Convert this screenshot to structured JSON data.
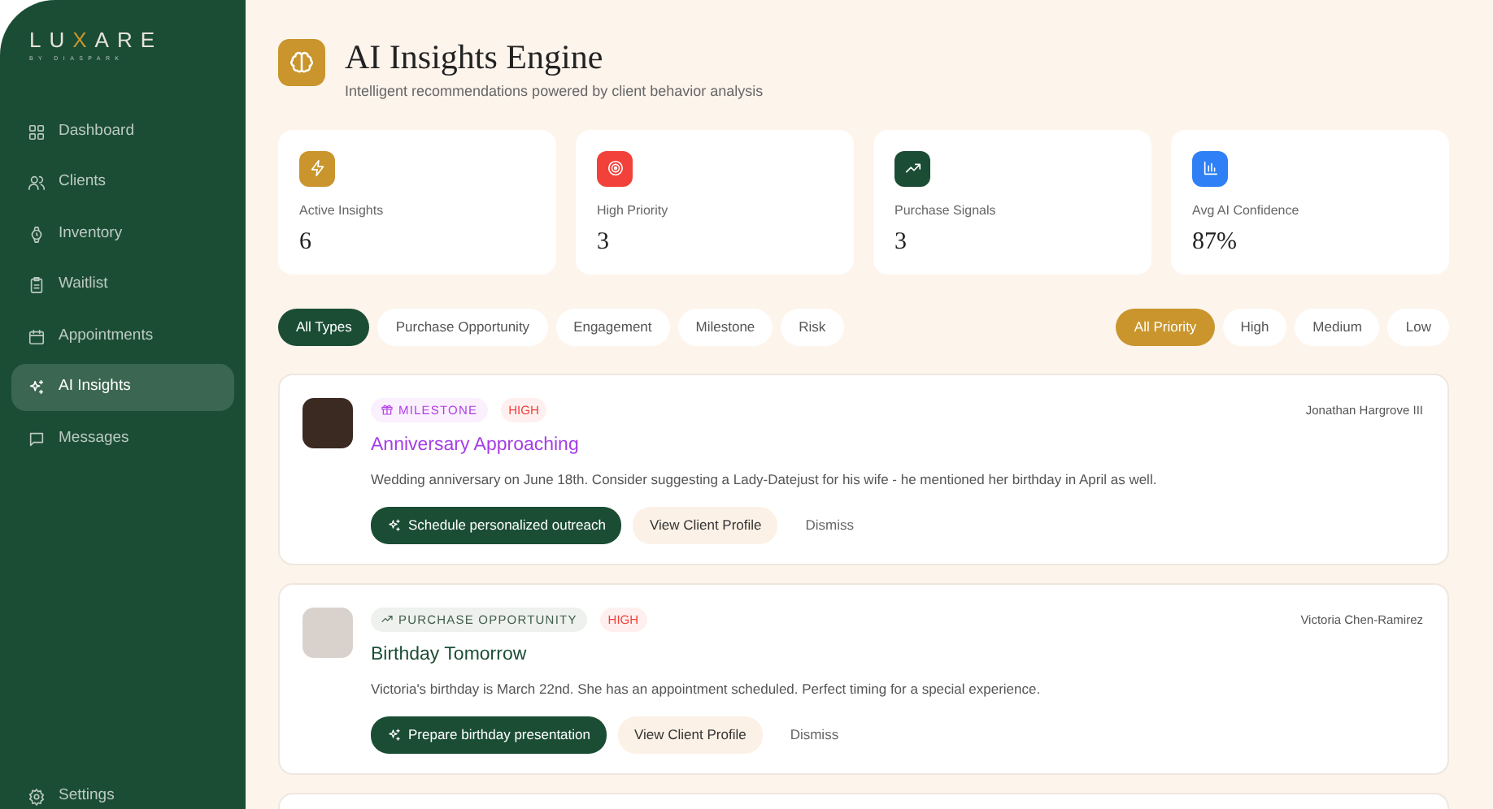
{
  "sidebar": {
    "logo": "LUXARE",
    "logo_subtitle": "BY DIASPARK",
    "items": [
      {
        "label": "Dashboard",
        "selected": false
      },
      {
        "label": "Clients",
        "selected": false
      },
      {
        "label": "Inventory",
        "selected": false
      },
      {
        "label": "Waitlist",
        "selected": false
      },
      {
        "label": "Appointments",
        "selected": false
      },
      {
        "label": "AI Insights",
        "selected": true
      },
      {
        "label": "Messages",
        "selected": false
      }
    ],
    "footer_item": "Settings"
  },
  "header": {
    "title": "AI Insights Engine",
    "subtitle": "Intelligent recommendations powered by client behavior analysis"
  },
  "stats": [
    {
      "label": "Active Insights",
      "value": "6",
      "color": "#c9952c"
    },
    {
      "label": "High Priority",
      "value": "3",
      "color": "#f2413a"
    },
    {
      "label": "Purchase Signals",
      "value": "3",
      "color": "#1b4d35"
    },
    {
      "label": "Avg AI Confidence",
      "value": "87%",
      "color": "#2f80f6"
    }
  ],
  "type_filters": [
    {
      "label": "All Types",
      "selected": true
    },
    {
      "label": "Purchase Opportunity",
      "selected": false
    },
    {
      "label": "Engagement",
      "selected": false
    },
    {
      "label": "Milestone",
      "selected": false
    },
    {
      "label": "Risk",
      "selected": false
    }
  ],
  "priority_filters": [
    {
      "label": "All Priority",
      "selected": true
    },
    {
      "label": "High",
      "selected": false
    },
    {
      "label": "Medium",
      "selected": false
    },
    {
      "label": "Low",
      "selected": false
    }
  ],
  "insights": [
    {
      "kind": "milestone",
      "category": "MILESTONE",
      "priority": "HIGH",
      "title": "Anniversary Approaching",
      "client": "Jonathan Hargrove III",
      "description": "Wedding anniversary on June 18th. Consider suggesting a Lady-Datejust for his wife - he mentioned her birthday in April as well.",
      "primary_action": "Schedule personalized outreach",
      "profile_action": "View Client Profile",
      "dismiss_action": "Dismiss"
    },
    {
      "kind": "purchase",
      "category": "PURCHASE OPPORTUNITY",
      "priority": "HIGH",
      "title": "Birthday Tomorrow",
      "client": "Victoria Chen-Ramirez",
      "description": "Victoria's birthday is March 22nd. She has an appointment scheduled. Perfect timing for a special experience.",
      "primary_action": "Prepare birthday presentation",
      "profile_action": "View Client Profile",
      "dismiss_action": "Dismiss"
    }
  ]
}
